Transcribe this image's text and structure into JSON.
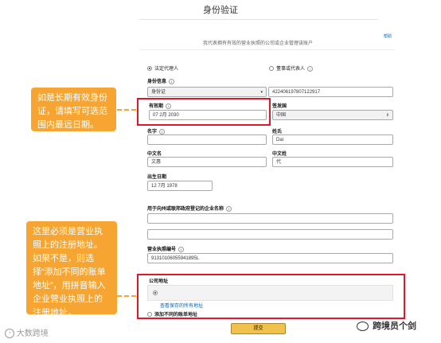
{
  "page": {
    "title": "身份验证",
    "help_link": "帮助",
    "subtitle": "我代表拥有有效的营业执照的公司或企业管理该账户"
  },
  "role": {
    "option_legal": "法定代理人",
    "option_director": "董事或代表人"
  },
  "identity": {
    "label": "身份信息",
    "doc_type": "身份证",
    "doc_number": "422406197807122917"
  },
  "expiry": {
    "label": "有效期",
    "value": "07 2月 2030"
  },
  "issuing_country": {
    "label": "签发国",
    "value": "中国"
  },
  "name": {
    "first_label": "名字",
    "first_value": "",
    "last_label": "姓氏",
    "last_value": "Dai",
    "cn_first_label": "中文名",
    "cn_first_value": "文惠",
    "cn_last_label": "中文姓",
    "cn_last_value": "代"
  },
  "dob": {
    "label": "出生日期",
    "value": "12 7月 1978"
  },
  "company": {
    "name_label": "用于向州或联邦政府登记的企业名称",
    "name_value": "",
    "name_value2": "",
    "license_label": "营业执照编号",
    "license_value": "91310106055941895L"
  },
  "address": {
    "label": "公司地址",
    "view_all_link": "查看保存的所有地址",
    "add_different": "添加不同的账单地址"
  },
  "submit_label": "提交",
  "callouts": {
    "expiry_note": "如是长期有效身份证，请填写可选范围内最远日期。",
    "address_note": "这里必须是营业执照上的注册地址。如果不是，则选择“添加不同的账单地址”，用拼音输入企业营业执照上的注册地址。"
  },
  "watermarks": {
    "left": "大数跨境",
    "right": "跨境员个剑"
  },
  "colors": {
    "callout": "#f7a532",
    "highlight": "#e0162b",
    "submit": "#f0c14b",
    "link": "#0066c0"
  }
}
